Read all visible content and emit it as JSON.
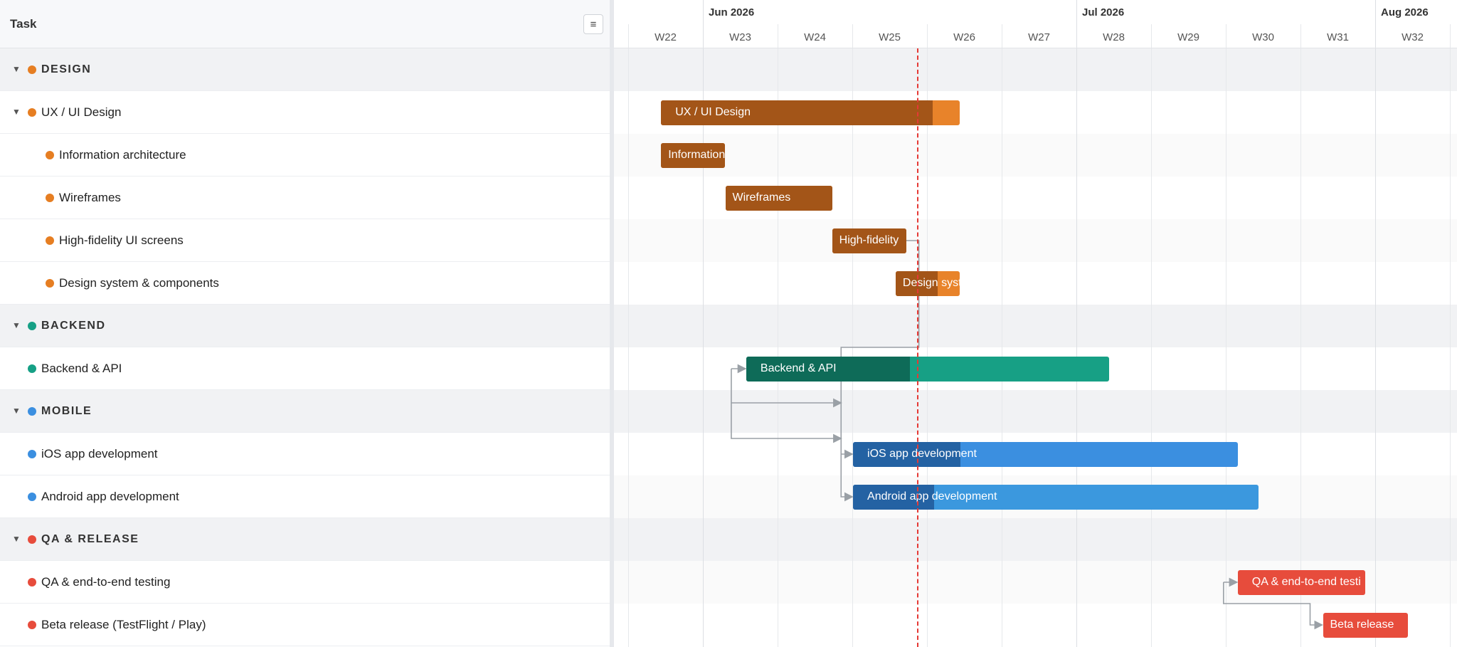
{
  "left_header": {
    "title": "Task",
    "menu_glyph": "≡"
  },
  "rows": [
    {
      "type": "group",
      "label": "DESIGN",
      "color": "#e67e22"
    },
    {
      "type": "parent",
      "label": "UX / UI Design",
      "color": "#e67e22"
    },
    {
      "type": "task",
      "label": "Information architecture",
      "color": "#e67e22"
    },
    {
      "type": "task",
      "label": "Wireframes",
      "color": "#e67e22"
    },
    {
      "type": "task",
      "label": "High-fidelity UI screens",
      "color": "#e67e22"
    },
    {
      "type": "task",
      "label": "Design system & components",
      "color": "#e67e22"
    },
    {
      "type": "group",
      "label": "BACKEND",
      "color": "#16a085"
    },
    {
      "type": "item",
      "label": "Backend & API",
      "color": "#16a085"
    },
    {
      "type": "group",
      "label": "MOBILE",
      "color": "#3b8fe0"
    },
    {
      "type": "item",
      "label": "iOS app development",
      "color": "#3b8fe0"
    },
    {
      "type": "item",
      "label": "Android app development",
      "color": "#3b8fe0"
    },
    {
      "type": "group",
      "label": "QA & RELEASE",
      "color": "#e74c3c"
    },
    {
      "type": "item",
      "label": "QA & end-to-end testing",
      "color": "#e74c3c"
    },
    {
      "type": "item",
      "label": "Beta release (TestFlight / Play)",
      "color": "#e74c3c"
    }
  ],
  "timeline": {
    "months": [
      "Jun 2026",
      "Jul 2026",
      "Aug 2026"
    ],
    "weeks": [
      "W22",
      "W23",
      "W24",
      "W25",
      "W26",
      "W27",
      "W28",
      "W29",
      "W30",
      "W31",
      "W32"
    ]
  },
  "bars": [
    {
      "row": 1,
      "label": "UX / UI Design",
      "start": 0.44,
      "end": 4.44,
      "progress": 0.91,
      "color": "#e8832a",
      "done_color": "#a35518"
    },
    {
      "row": 2,
      "label": "Information",
      "start": 0.44,
      "end": 1.3,
      "progress": 1.0,
      "color": "#e8832a",
      "done_color": "#a35518"
    },
    {
      "row": 3,
      "label": "Wireframes",
      "start": 1.3,
      "end": 2.73,
      "progress": 1.0,
      "color": "#e8832a",
      "done_color": "#a35518"
    },
    {
      "row": 4,
      "label": "High-fidelity",
      "start": 2.73,
      "end": 3.72,
      "progress": 1.0,
      "color": "#e8832a",
      "done_color": "#a35518"
    },
    {
      "row": 5,
      "label": "Design syst",
      "start": 3.58,
      "end": 4.44,
      "progress": 0.65,
      "color": "#e8832a",
      "done_color": "#a35518"
    },
    {
      "row": 7,
      "label": "Backend & API",
      "start": 1.58,
      "end": 6.44,
      "progress": 0.45,
      "color": "#17a085",
      "done_color": "#0e6b58"
    },
    {
      "row": 9,
      "label": "iOS app development",
      "start": 3.01,
      "end": 8.16,
      "progress": 0.28,
      "color": "#3b8fe0",
      "done_color": "#2462a3"
    },
    {
      "row": 10,
      "label": "Android app development",
      "start": 3.01,
      "end": 8.44,
      "progress": 0.2,
      "color": "#3b98de",
      "done_color": "#2462a3"
    },
    {
      "row": 12,
      "label": "QA & end-to-end testi",
      "start": 8.16,
      "end": 9.87,
      "progress": 0.0,
      "color": "#e74c3c",
      "done_color": "#b33327"
    },
    {
      "row": 13,
      "label": "Beta release",
      "start": 9.3,
      "end": 10.44,
      "progress": 0.0,
      "color": "#e74c3c",
      "done_color": "#b33327"
    }
  ],
  "today_week": 3.88
}
